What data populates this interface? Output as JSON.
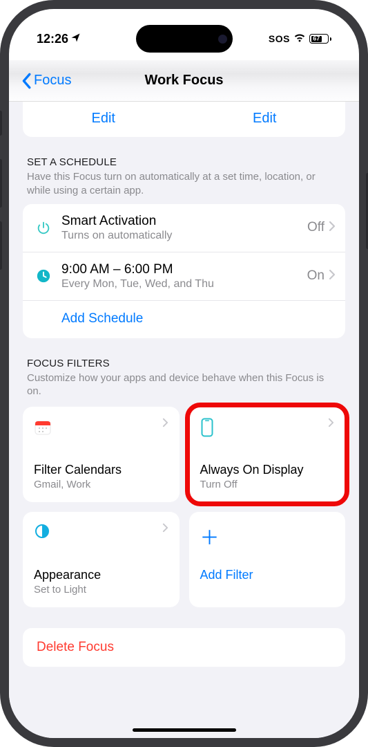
{
  "status": {
    "time": "12:26",
    "sos": "SOS",
    "battery_pct": "67"
  },
  "nav": {
    "back_label": "Focus",
    "title": "Work Focus"
  },
  "top_edits": {
    "edit1": "Edit",
    "edit2": "Edit"
  },
  "schedule": {
    "title": "Set a Schedule",
    "desc": "Have this Focus turn on automatically at a set time, location, or while using a certain app.",
    "smart": {
      "title": "Smart Activation",
      "sub": "Turns on automatically",
      "value": "Off"
    },
    "time": {
      "title": "9:00 AM – 6:00 PM",
      "sub": "Every Mon, Tue, Wed, and Thu",
      "value": "On"
    },
    "add": "Add Schedule"
  },
  "filters": {
    "title": "Focus Filters",
    "desc": "Customize how your apps and device behave when this Focus is on.",
    "calendars": {
      "title": "Filter Calendars",
      "sub": "Gmail, Work"
    },
    "aod": {
      "title": "Always On Display",
      "sub": "Turn Off"
    },
    "appearance": {
      "title": "Appearance",
      "sub": "Set to Light"
    },
    "add": "Add Filter"
  },
  "delete_label": "Delete Focus"
}
